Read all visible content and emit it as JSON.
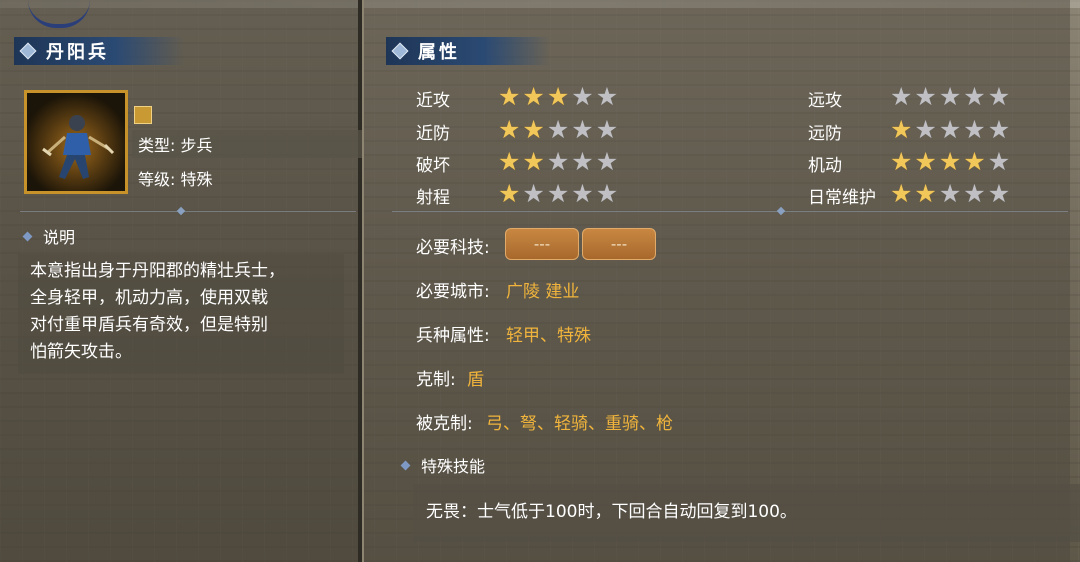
{
  "unit": {
    "name": "丹阳兵",
    "type_text": "类型: 步兵",
    "level_text": "等级: 特殊"
  },
  "description": {
    "heading": "说明",
    "lines": [
      "本意指出身于丹阳郡的精壮兵士，",
      "全身轻甲，机动力高，使用双戟",
      "对付重甲盾兵有奇效，但是特别",
      "怕箭矢攻击。"
    ]
  },
  "attributes": {
    "heading": "属性",
    "left": [
      {
        "label": "近攻",
        "stars": 3
      },
      {
        "label": "近防",
        "stars": 2
      },
      {
        "label": "破坏",
        "stars": 2
      },
      {
        "label": "射程",
        "stars": 1
      }
    ],
    "right": [
      {
        "label": "远攻",
        "stars": 0
      },
      {
        "label": "远防",
        "stars": 1
      },
      {
        "label": "机动",
        "stars": 4
      },
      {
        "label": "日常维护",
        "stars": 2
      }
    ],
    "max_stars": 5
  },
  "requirements": {
    "tech_label": "必要科技:",
    "tech_slots": [
      "---",
      "---"
    ],
    "city_label": "必要城市:",
    "city_value": "广陵 建业",
    "troop_label": "兵种属性:",
    "troop_value": "轻甲、特殊",
    "counter_label": "克制:",
    "counter_value": "盾",
    "countered_label": "被克制:",
    "countered_value": "弓、弩、轻骑、重骑、枪"
  },
  "skill": {
    "heading": "特殊技能",
    "text": "无畏：士气低于100时，下回合自动回复到100。"
  },
  "colors": {
    "star_on": "#f2c75a",
    "star_off": "#c0c0c4",
    "highlight_text": "#f0b43c",
    "title_bar": "#2b4a73"
  }
}
